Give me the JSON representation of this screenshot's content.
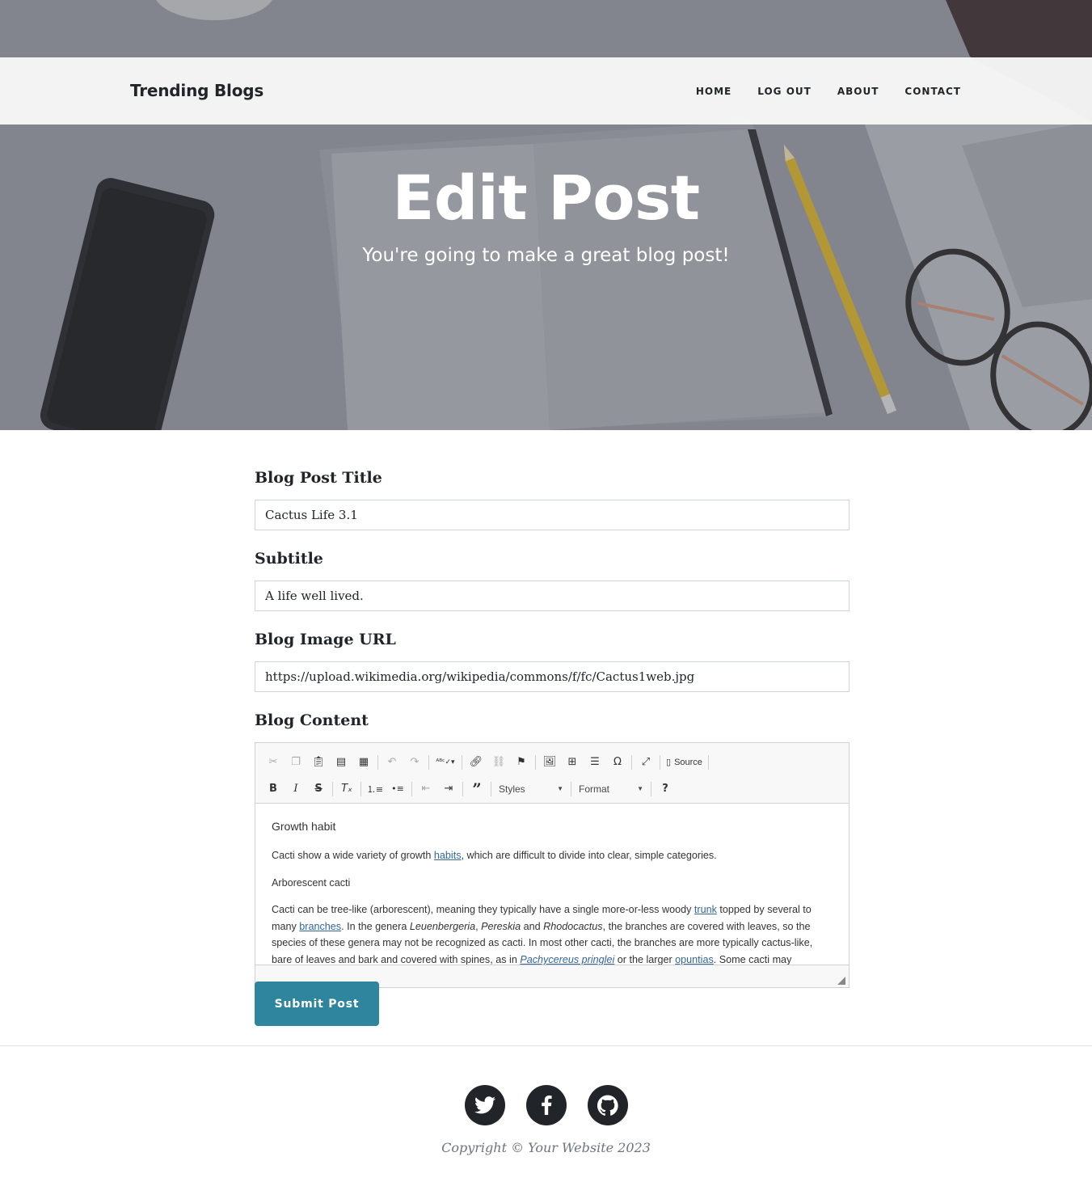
{
  "nav": {
    "brand": "Trending Blogs",
    "links": [
      "HOME",
      "LOG OUT",
      "ABOUT",
      "CONTACT"
    ]
  },
  "hero": {
    "title": "Edit Post",
    "subtitle": "You're going to make a great blog post!"
  },
  "form": {
    "title_label": "Blog Post Title",
    "title_value": "Cactus Life 3.1",
    "subtitle_label": "Subtitle",
    "subtitle_value": "A life well lived.",
    "image_label": "Blog Image URL",
    "image_value": "https://upload.wikimedia.org/wikipedia/commons/f/fc/Cactus1web.jpg",
    "content_label": "Blog Content",
    "submit_label": "Submit Post"
  },
  "editor": {
    "toolbar_row1": [
      "cut-icon",
      "copy-icon",
      "paste-icon",
      "paste-text-icon",
      "paste-word-icon",
      "undo-icon",
      "redo-icon",
      "spellcheck-icon",
      "link-icon",
      "unlink-icon",
      "anchor-icon",
      "image-icon",
      "table-icon",
      "horizontal-rule-icon",
      "special-char-icon",
      "maximize-icon",
      "source-icon"
    ],
    "source_label": "Source",
    "styles_label": "Styles",
    "format_label": "Format",
    "heading": "Growth habit",
    "p1_before": "Cacti show a wide variety of growth ",
    "p1_link": "habits",
    "p1_after": ", which are difficult to divide into clear, simple categories.",
    "p2": "Arborescent cacti",
    "p3_a": "Cacti can be tree-like (arborescent), meaning they typically have a single more-or-less woody ",
    "p3_link1": "trunk",
    "p3_b": " topped by several to many ",
    "p3_link2": "branches",
    "p3_c": ". In the genera ",
    "p3_i1": "Leuenbergeria",
    "p3_d": ", ",
    "p3_i2": "Pereskia",
    "p3_e": " and ",
    "p3_i3": "Rhodocactus",
    "p3_f": ", the branches are covered with leaves, so the species of these genera may not be recognized as cacti. In most other cacti, the branches are more typically cactus-like, bare of leaves and bark and covered with spines, as in ",
    "p3_link3": "Pachycereus pringlei",
    "p3_g": " or the larger ",
    "p3_link4": "opuntias",
    "p3_h": ". Some cacti may"
  },
  "footer": {
    "icons": [
      "twitter-icon",
      "facebook-icon",
      "github-icon"
    ],
    "copyright": "Copyright © Your Website 2023"
  },
  "colors": {
    "accent": "#2f849e",
    "dark": "#212529",
    "link": "#336699"
  }
}
